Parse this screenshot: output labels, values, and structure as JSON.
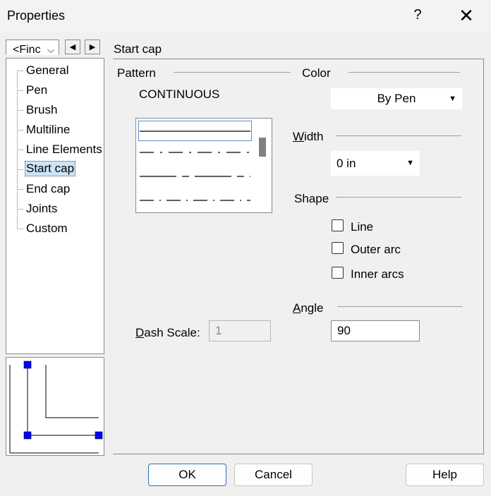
{
  "window": {
    "title": "Properties",
    "help_glyph": "?",
    "close_glyph": "✕"
  },
  "sidebar": {
    "find_label": "<Finc",
    "find_chevron": "⌵",
    "prev_glyph": "◀",
    "next_glyph": "▶",
    "tree_items": [
      {
        "label": "General"
      },
      {
        "label": "Pen"
      },
      {
        "label": "Brush"
      },
      {
        "label": "Multiline"
      },
      {
        "label": "Line Elements"
      },
      {
        "label": "Start cap",
        "selected": true
      },
      {
        "label": "End cap"
      },
      {
        "label": "Joints"
      },
      {
        "label": "Custom"
      }
    ]
  },
  "section": {
    "title": "Start cap"
  },
  "pattern": {
    "label": "Pattern",
    "current": "CONTINUOUS"
  },
  "color": {
    "label": "Color",
    "value": "By Pen",
    "arrow": "▼"
  },
  "width": {
    "label_accel": "W",
    "label_rest": "idth",
    "value": "0 in",
    "arrow": "▼"
  },
  "shape": {
    "label": "Shape",
    "options": [
      {
        "label": "Line",
        "checked": false
      },
      {
        "label": "Outer arc",
        "checked": false
      },
      {
        "label": "Inner arcs",
        "checked": false
      }
    ]
  },
  "angle": {
    "label_accel": "A",
    "label_rest": "ngle",
    "value": "90"
  },
  "dash_scale": {
    "label_accel": "D",
    "label_rest": "ash Scale:",
    "value": "1"
  },
  "buttons": {
    "ok": "OK",
    "cancel": "Cancel",
    "help": "Help"
  },
  "colors": {
    "selection": "#cce4f7",
    "handle": "#0000ff",
    "default_border": "#2b6fb6"
  }
}
